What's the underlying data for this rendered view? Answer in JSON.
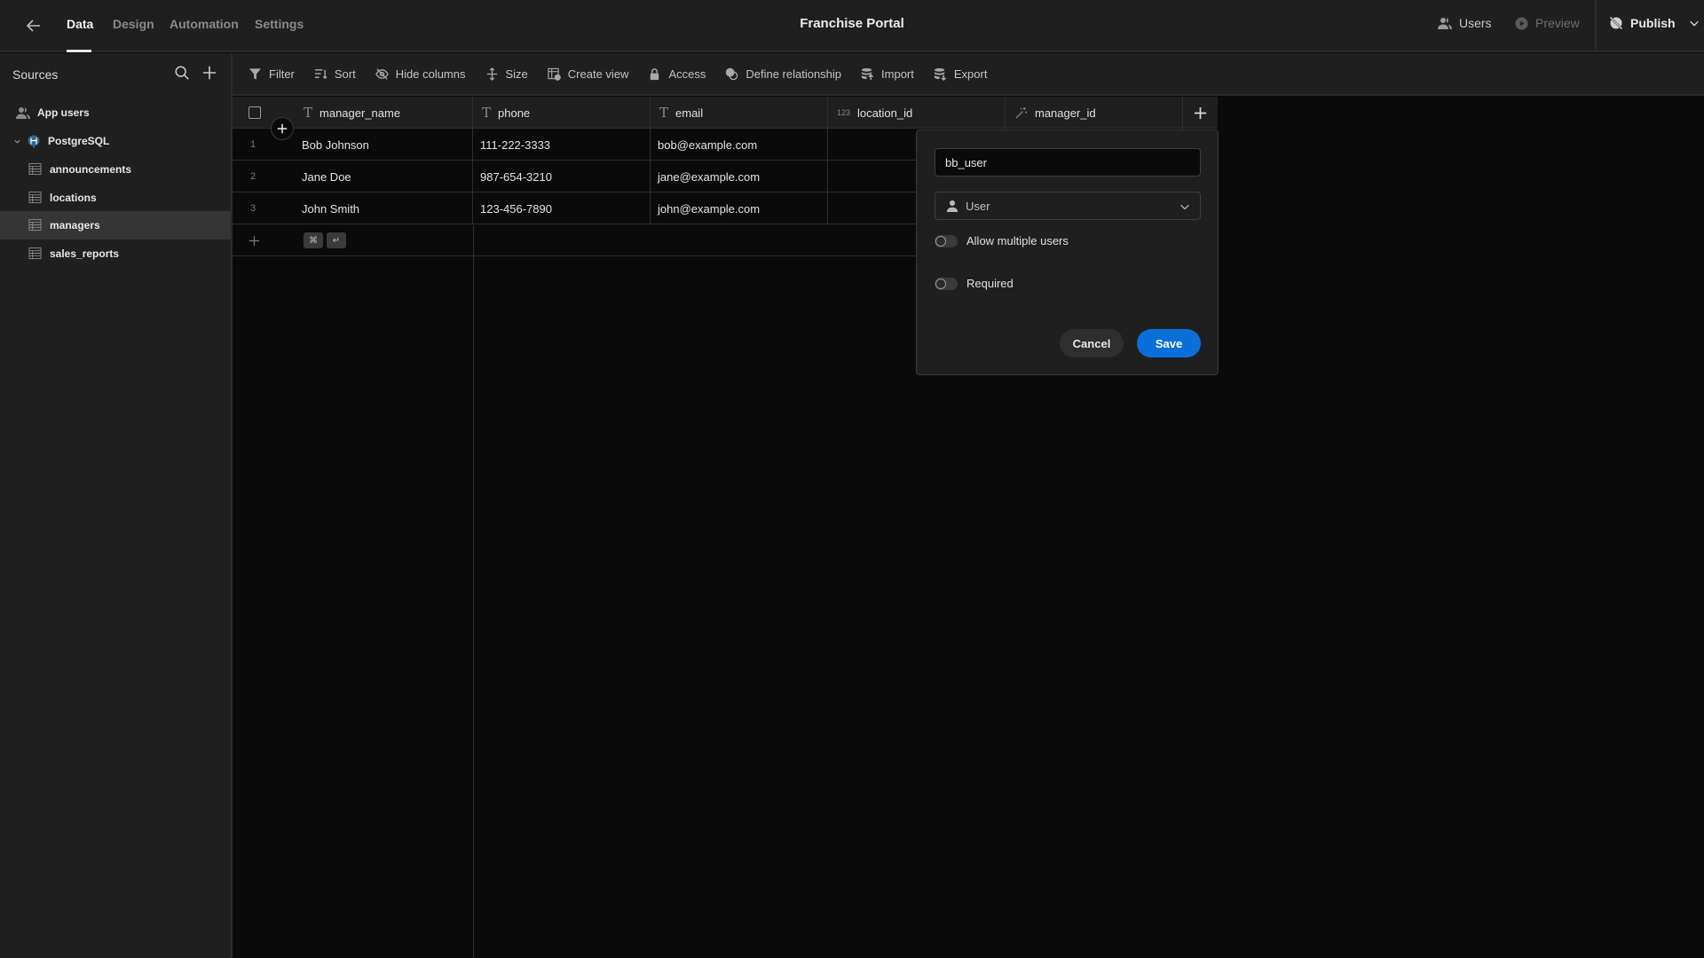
{
  "topbar": {
    "back_icon": "arrow-left-icon",
    "tabs": [
      {
        "label": "Data",
        "active": true
      },
      {
        "label": "Design",
        "active": false
      },
      {
        "label": "Automation",
        "active": false
      },
      {
        "label": "Settings",
        "active": false
      }
    ],
    "title": "Franchise Portal",
    "users_label": "Users",
    "preview_label": "Preview",
    "publish_label": "Publish"
  },
  "sidebar": {
    "title": "Sources",
    "items": [
      {
        "label": "App users",
        "icon": "users-icon"
      },
      {
        "label": "PostgreSQL",
        "icon": "postgresql-icon",
        "expanded": true
      },
      {
        "label": "announcements",
        "icon": "table-icon"
      },
      {
        "label": "locations",
        "icon": "table-icon"
      },
      {
        "label": "managers",
        "icon": "table-icon",
        "selected": true
      },
      {
        "label": "sales_reports",
        "icon": "table-icon"
      }
    ]
  },
  "toolbar": {
    "filter": "Filter",
    "sort": "Sort",
    "hide_columns": "Hide columns",
    "size": "Size",
    "create_view": "Create view",
    "access": "Access",
    "define_relationship": "Define relationship",
    "import": "Import",
    "export": "Export"
  },
  "table": {
    "columns": [
      {
        "name": "manager_name",
        "type": "text",
        "type_glyph": "T"
      },
      {
        "name": "phone",
        "type": "text",
        "type_glyph": "T"
      },
      {
        "name": "email",
        "type": "text",
        "type_glyph": "T"
      },
      {
        "name": "location_id",
        "type": "number",
        "type_glyph": "123"
      },
      {
        "name": "manager_id",
        "type": "auto",
        "type_glyph": "magic-wand"
      }
    ],
    "rows": [
      {
        "num": "1",
        "manager_name": "Bob Johnson",
        "phone": "111-222-3333",
        "email": "bob@example.com"
      },
      {
        "num": "2",
        "manager_name": "Jane Doe",
        "phone": "987-654-3210",
        "email": "jane@example.com"
      },
      {
        "num": "3",
        "manager_name": "John Smith",
        "phone": "123-456-7890",
        "email": "john@example.com"
      }
    ],
    "add_row_shortcut": [
      "⌘",
      "↵"
    ]
  },
  "popup": {
    "column_name_value": "bb_user",
    "type_selected": "User",
    "allow_multiple_label": "Allow multiple users",
    "allow_multiple_on": false,
    "required_label": "Required",
    "required_on": false,
    "cancel_label": "Cancel",
    "save_label": "Save"
  },
  "colors": {
    "accent": "#0b6fd9",
    "panel_bg": "#1f1f1f",
    "grid_bg": "#0a0a0a",
    "selected_item_bg": "#353535"
  }
}
